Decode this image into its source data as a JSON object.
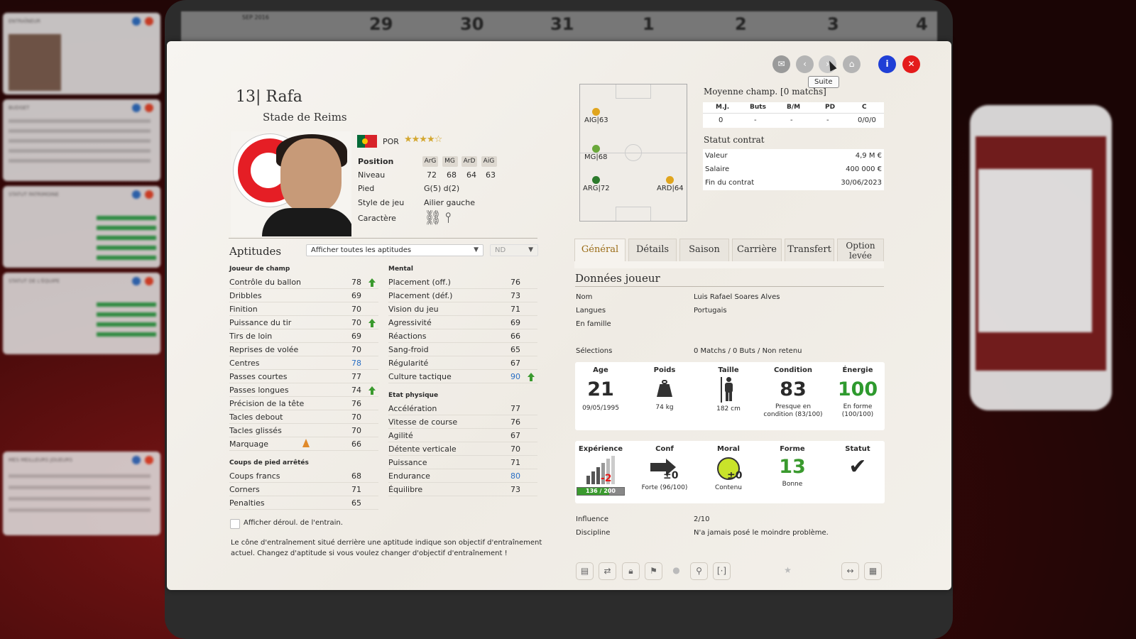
{
  "window_title_tooltip": "Suite",
  "player": {
    "number": "13",
    "name": "Rafa",
    "club": "Stade de Reims",
    "nationality": "POR",
    "stars": "★★★★☆",
    "position_label": "Position",
    "positions": [
      "ArG",
      "MG",
      "ArD",
      "AiG"
    ],
    "level_label": "Niveau",
    "levels": [
      "72",
      "68",
      "64",
      "63"
    ],
    "foot_label": "Pied",
    "foot": "G(5) d(2)",
    "style_label": "Style de jeu",
    "style": "Ailier gauche",
    "character_label": "Caractère"
  },
  "aptitudes": {
    "title": "Aptitudes",
    "filter": "Afficher toutes les aptitudes",
    "filter2": "ND",
    "field_header": "Joueur de champ",
    "field": [
      {
        "label": "Contrôle du ballon",
        "value": "78",
        "up": true
      },
      {
        "label": "Dribbles",
        "value": "69"
      },
      {
        "label": "Finition",
        "value": "70"
      },
      {
        "label": "Puissance du tir",
        "value": "70",
        "up": true
      },
      {
        "label": "Tirs de loin",
        "value": "69"
      },
      {
        "label": "Reprises de volée",
        "value": "70"
      },
      {
        "label": "Centres",
        "value": "78",
        "blue": true
      },
      {
        "label": "Passes courtes",
        "value": "77"
      },
      {
        "label": "Passes longues",
        "value": "74",
        "up": true
      },
      {
        "label": "Précision de la tête",
        "value": "76"
      },
      {
        "label": "Tacles debout",
        "value": "70"
      },
      {
        "label": "Tacles glissés",
        "value": "70"
      },
      {
        "label": "Marquage",
        "value": "66",
        "cone": true
      }
    ],
    "setpiece_header": "Coups de pied arrêtés",
    "setpiece": [
      {
        "label": "Coups francs",
        "value": "68"
      },
      {
        "label": "Corners",
        "value": "71"
      },
      {
        "label": "Penalties",
        "value": "65"
      }
    ],
    "mental_header": "Mental",
    "mental": [
      {
        "label": "Placement (off.)",
        "value": "76"
      },
      {
        "label": "Placement (déf.)",
        "value": "73"
      },
      {
        "label": "Vision du jeu",
        "value": "71"
      },
      {
        "label": "Agressivité",
        "value": "69"
      },
      {
        "label": "Réactions",
        "value": "66"
      },
      {
        "label": "Sang-froid",
        "value": "65"
      },
      {
        "label": "Régularité",
        "value": "67"
      },
      {
        "label": "Culture tactique",
        "value": "90",
        "blue": true,
        "up": true
      }
    ],
    "physical_header": "Etat physique",
    "physical": [
      {
        "label": "Accélération",
        "value": "77"
      },
      {
        "label": "Vitesse de course",
        "value": "76"
      },
      {
        "label": "Agilité",
        "value": "67"
      },
      {
        "label": "Détente verticale",
        "value": "70"
      },
      {
        "label": "Puissance",
        "value": "71"
      },
      {
        "label": "Endurance",
        "value": "80",
        "blue": true
      },
      {
        "label": "Équilibre",
        "value": "73"
      }
    ],
    "checkbox_label": "Afficher déroul. de l'entrain.",
    "note": "Le cône d'entraînement situé derrière une aptitude indique son objectif d'entraînement actuel. Changez d'aptitude si vous voulez changer d'objectif d'entraînement !"
  },
  "pitch_positions": [
    {
      "label": "AIG|63",
      "color": "#e0a51e"
    },
    {
      "label": "MG|68",
      "color": "#6aa83a"
    },
    {
      "label": "ARG|72",
      "color": "#2c7a2c"
    },
    {
      "label": "ARD|64",
      "color": "#e0a51e"
    }
  ],
  "avg": {
    "title": "Moyenne champ. [0 matchs]",
    "headers": [
      "M.J.",
      "Buts",
      "B/M",
      "PD",
      "C"
    ],
    "values": [
      "0",
      "-",
      "-",
      "-",
      "0/0/0"
    ]
  },
  "contract": {
    "title": "Statut contrat",
    "rows": [
      {
        "label": "Valeur",
        "value": "4,9 M €"
      },
      {
        "label": "Salaire",
        "value": "400 000 €"
      },
      {
        "label": "Fin du contrat",
        "value": "30/06/2023"
      }
    ]
  },
  "tabs": [
    "Général",
    "Détails",
    "Saison",
    "Carrière",
    "Transfert",
    "Option levée"
  ],
  "general": {
    "title": "Données joueur",
    "name_label": "Nom",
    "name": "Luis Rafael Soares Alves",
    "lang_label": "Langues",
    "lang": "Portugais",
    "family_label": "En famille",
    "sel_label": "Sélections",
    "sel": "0 Matchs / 0 Buts / Non retenu",
    "age_h": "Age",
    "age": "21",
    "dob": "09/05/1995",
    "weight_h": "Poids",
    "weight": "74 kg",
    "height_h": "Taille",
    "height": "182 cm",
    "cond_h": "Condition",
    "cond": "83",
    "cond_s": "Presque en condition (83/100)",
    "energy_h": "Énergie",
    "energy": "100",
    "energy_s": "En forme (100/100)",
    "exp_h": "Expérience",
    "exp_delta": "-2",
    "exp_bar": "136 / 200",
    "exp_fraction": 0.68,
    "conf_h": "Conf",
    "conf_delta": "±0",
    "conf_s": "Forte (96/100)",
    "moral_h": "Moral",
    "moral_delta": "±0",
    "moral_s": "Contenu",
    "form_h": "Forme",
    "form": "13",
    "form_s": "Bonne",
    "status_h": "Statut",
    "influence_label": "Influence",
    "influence": "2/10",
    "discipline_label": "Discipline",
    "discipline": "N'a jamais posé le moindre problème."
  },
  "colors": {
    "close": "#e41b1b",
    "info": "#1f3fd6",
    "green": "#2e9a2e",
    "blue": "#2a6fc4",
    "accent": "#9a6b15"
  }
}
